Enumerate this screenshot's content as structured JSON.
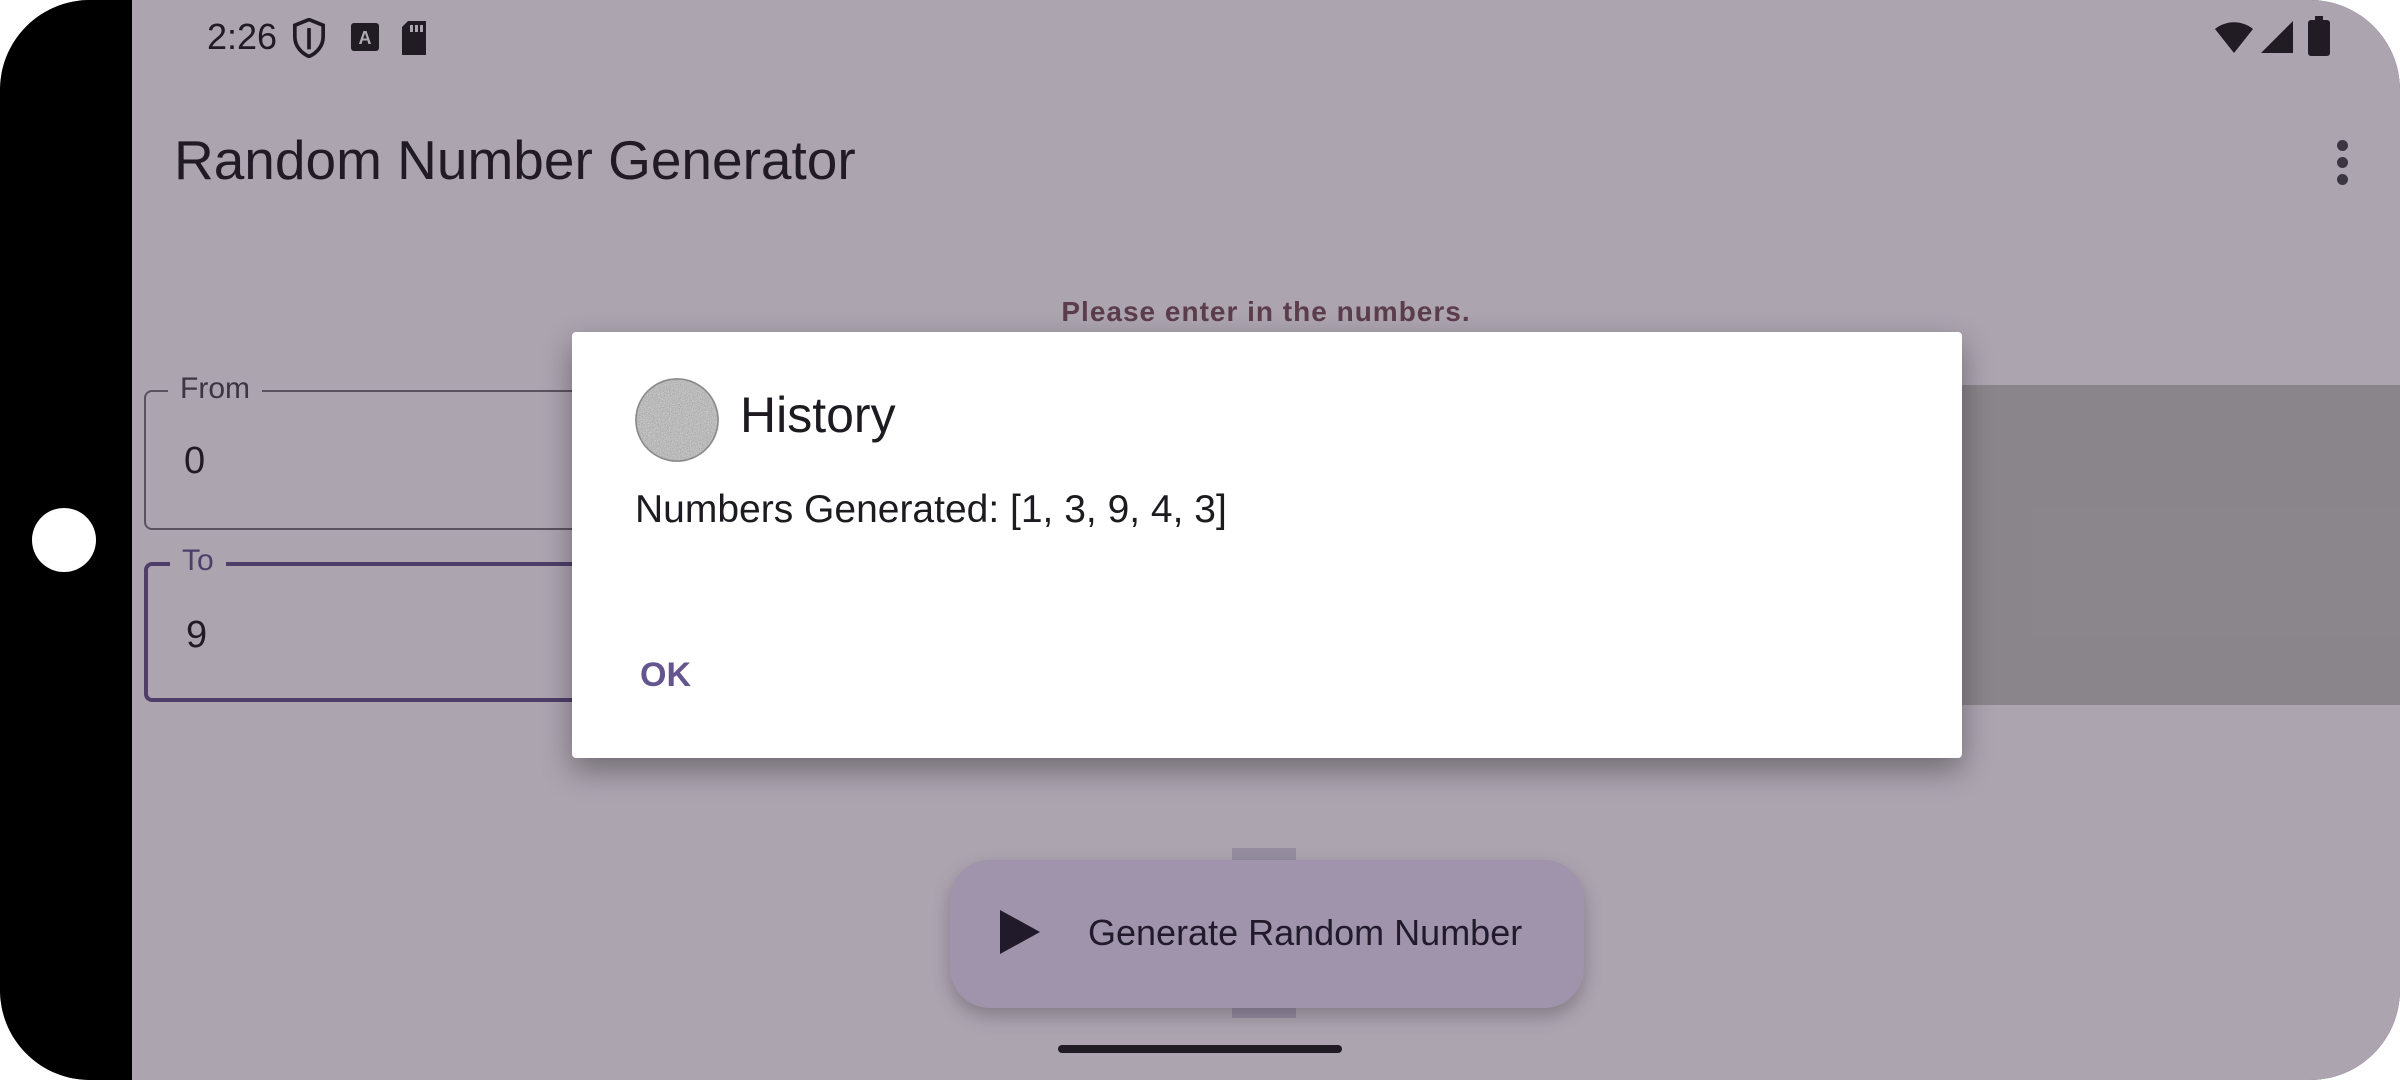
{
  "status_bar": {
    "time": "2:26",
    "left_icons": [
      "shield-icon",
      "font-a-icon",
      "sd-card-icon"
    ],
    "right_icons": [
      "wifi-icon",
      "signal-icon",
      "battery-icon"
    ]
  },
  "app_bar": {
    "title": "Random Number Generator",
    "menu_icon": "more-vert-icon"
  },
  "main": {
    "prompt": "Please enter in the numbers.",
    "from_field": {
      "label": "From",
      "value": "0"
    },
    "to_field": {
      "label": "To",
      "value": "9"
    },
    "generate_button": {
      "label": "Generate Random Number",
      "icon": "play-icon"
    }
  },
  "dialog": {
    "title": "History",
    "icon": "noise-avatar-icon",
    "message": "Numbers Generated: [1, 3, 9, 4, 3]",
    "ok_label": "OK"
  },
  "colors": {
    "primary": "#65558f",
    "tertiary": "#7d5260",
    "fab_container": "#e8def8",
    "surface": "#fdf7ff"
  }
}
